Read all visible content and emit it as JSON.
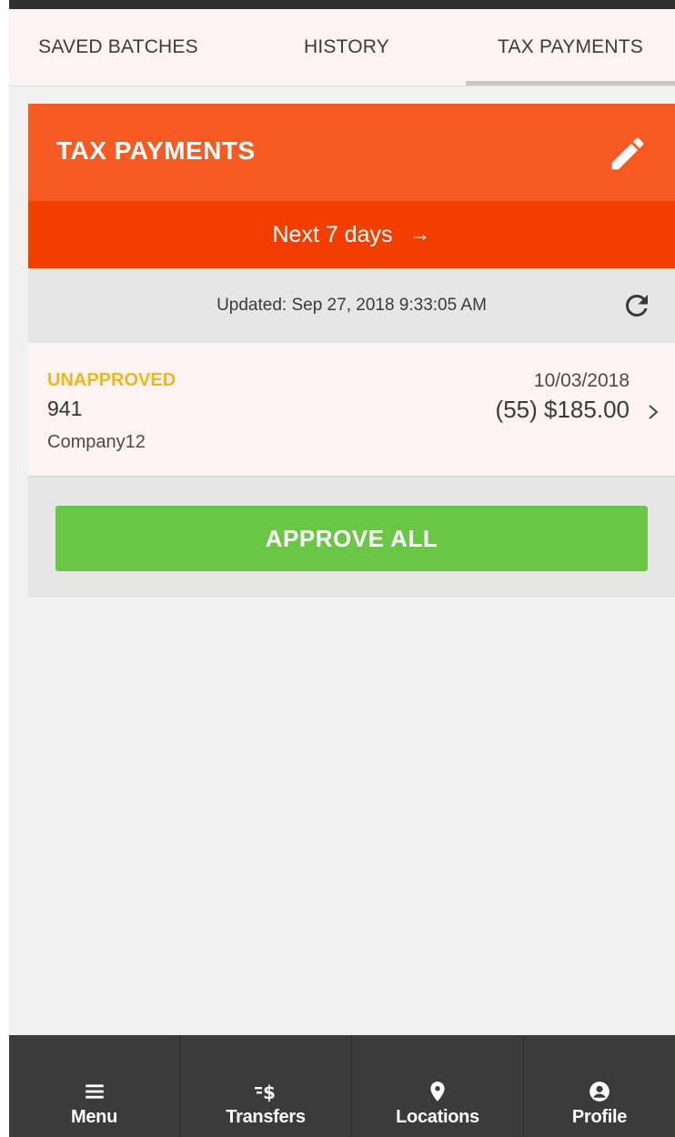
{
  "tabs": [
    {
      "label": "SAVED BATCHES",
      "active": false
    },
    {
      "label": "HISTORY",
      "active": false
    },
    {
      "label": "TAX PAYMENTS",
      "active": true
    }
  ],
  "card": {
    "title": "TAX PAYMENTS",
    "range_label": "Next 7 days",
    "range_arrow": "→",
    "updated_text": "Updated: Sep 27, 2018 9:33:05 AM",
    "payment": {
      "status": "UNAPPROVED",
      "form": "941",
      "company": "Company12",
      "date": "10/03/2018",
      "amount": "(55) $185.00"
    },
    "approve_label": "APPROVE ALL"
  },
  "bottom_nav": [
    {
      "label": "Menu",
      "icon": "menu-icon"
    },
    {
      "label": "Transfers",
      "icon": "transfers-icon"
    },
    {
      "label": "Locations",
      "icon": "location-pin-icon"
    },
    {
      "label": "Profile",
      "icon": "profile-icon"
    }
  ],
  "colors": {
    "header": "#f85a23",
    "range_bar": "#f43e00",
    "status_unapproved": "#f2b51f",
    "approve": "#6ac746",
    "nav": "#3b3b3b"
  }
}
